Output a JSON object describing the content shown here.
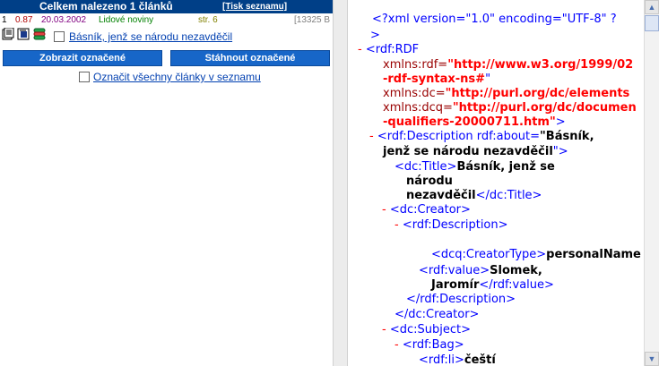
{
  "header": {
    "title": "Celkem nalezeno 1 článků",
    "print_link": "[Tisk seznamu]"
  },
  "result": {
    "num": "1",
    "score": "0.87",
    "date": "20.03.2002",
    "source": "Lidové noviny",
    "page": "str. 6",
    "size": "[13325 B",
    "title": "Básník, jenž se národu nezavděčil"
  },
  "buttons": {
    "show_selected": "Zobrazit označené",
    "download_selected": "Stáhnout označené"
  },
  "select_all_label": "Označit všechny články v seznamu",
  "icons": {
    "doc": "document-icon",
    "pdf": "pdf-icon",
    "db": "database-icon"
  },
  "xml": {
    "decl": "<?xml version=\"1.0\" encoding=\"UTF-8\" ?",
    "decl_end": ">",
    "rdf_open": "<rdf:RDF",
    "ns_rdf_attr": "xmlns:rdf=",
    "ns_rdf_val_1": "\"http://www.w3.org/1999/02",
    "ns_rdf_val_2": "-rdf-syntax-ns#",
    "ns_rdf_val_end": "\"",
    "ns_dc_attr": "xmlns:dc=",
    "ns_dc_val": "\"http://purl.org/dc/elements",
    "ns_dcq_attr": "xmlns:dcq=",
    "ns_dcq_val_1": "\"http://purl.org/dc/documen",
    "ns_dcq_val_2": "-qualifiers-20000711.htm\"",
    "ns_end": ">",
    "desc_open": "<rdf:Description rdf:about=",
    "about_1": "\"Básník,",
    "about_2": "jenž se národu nezavděčil",
    "about_end": "\">",
    "title_open": "<dc:Title>",
    "title_1": "Básník, jenž se",
    "title_2": "národu",
    "title_3": "nezavděčil",
    "title_close": "</dc:Title>",
    "creator_open": "<dc:Creator>",
    "creator_desc_open": "<rdf:Description>",
    "creatortype_open": "<dcq:CreatorType>",
    "creatortype_val": "personalName",
    "value_open": "<rdf:value>",
    "value_1": "Slomek,",
    "value_2": "Jaromír",
    "value_close": "</rdf:value>",
    "creator_desc_close": "</rdf:Description>",
    "creator_close": "</dc:Creator>",
    "subject_open": "<dc:Subject>",
    "bag_open": "<rdf:Bag>",
    "li_open": "<rdf:li>",
    "li_val": "čeští"
  },
  "colors": {
    "header_bg": "#003f87",
    "button_bg": "#1766c8",
    "link": "#003fb0",
    "xml_markup": "#0000ff",
    "xml_value": "#ff0000"
  }
}
